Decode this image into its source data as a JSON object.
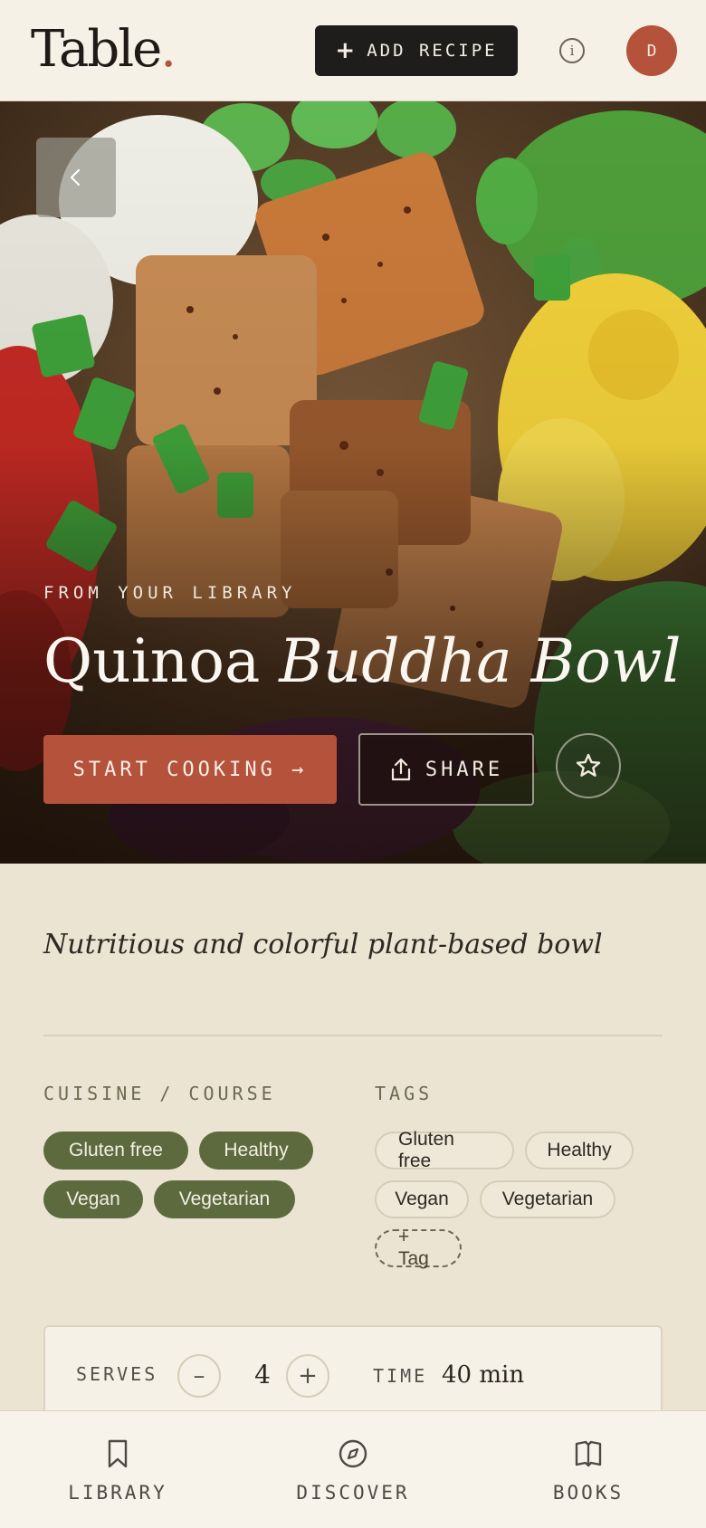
{
  "header": {
    "logo_text": "Table",
    "logo_dot": ".",
    "add_recipe_label": "ADD RECIPE",
    "avatar_initial": "D",
    "info_glyph": "i"
  },
  "hero": {
    "eyebrow": "FROM YOUR LIBRARY",
    "title_plain": "Quinoa ",
    "title_italic": "Buddha Bowl",
    "start_cooking_label": "START COOKING →",
    "share_label": "SHARE"
  },
  "recipe": {
    "subtitle": "Nutritious and colorful plant-based bowl"
  },
  "cuisine_course": {
    "label": "CUISINE / COURSE",
    "chips": [
      "Gluten free",
      "Healthy",
      "Vegan",
      "Vegetarian"
    ]
  },
  "tags": {
    "label": "TAGS",
    "chips": [
      "Gluten free",
      "Healthy",
      "Vegan",
      "Vegetarian"
    ],
    "add_label": "+ Tag"
  },
  "info": {
    "serves_label": "SERVES",
    "serves_value": "4",
    "minus": "–",
    "plus": "+",
    "time_label": "TIME",
    "time_value": "40 min"
  },
  "bottom_nav": {
    "items": [
      {
        "label": "LIBRARY",
        "icon": "bookmark-icon"
      },
      {
        "label": "DISCOVER",
        "icon": "compass-icon"
      },
      {
        "label": "BOOKS",
        "icon": "book-icon"
      }
    ]
  },
  "colors": {
    "accent": "#b5523b",
    "olive": "#5c6a3e",
    "background": "#ece4d2",
    "dark": "#1f1d1b"
  }
}
